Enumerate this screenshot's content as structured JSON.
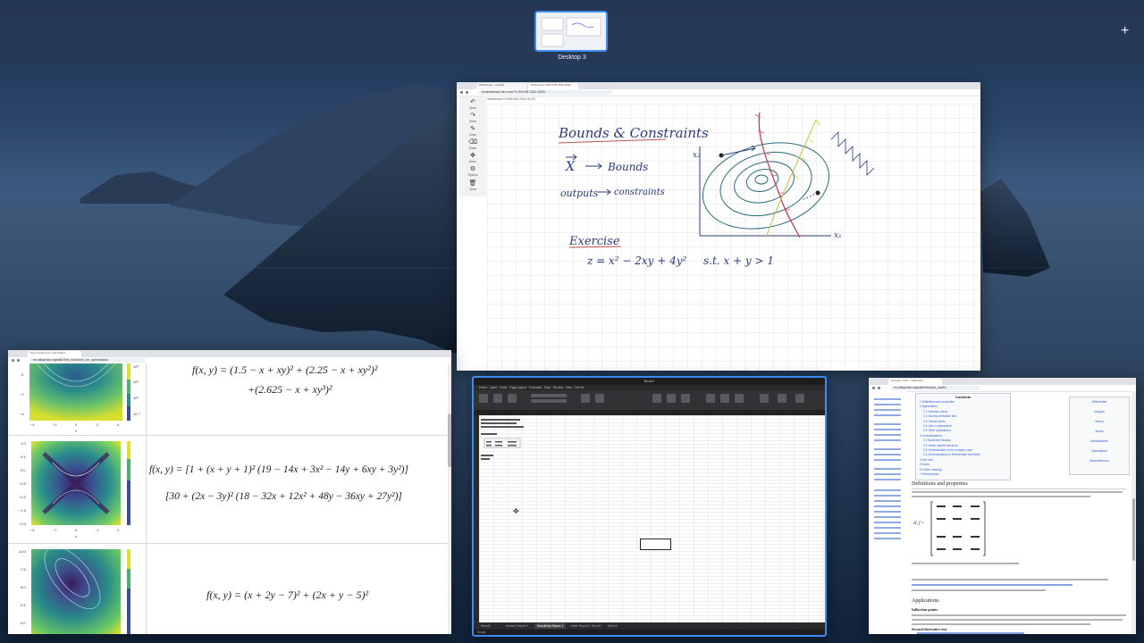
{
  "spaces": {
    "desktop_label": "Desktop 3",
    "add_symbol": "+"
  },
  "whiteboard": {
    "tabs": [
      "Whiteboard · Untitled",
      "Whiteboard 01BH13B-7842-9DZ0"
    ],
    "url": "ni.whiteboard-fire.com/?l=9H13B-7842-9DZ0",
    "board_name": "Whiteboard 01BH13B-7842-9DZ0",
    "tools": [
      {
        "icon": "undo-icon",
        "label": "Undo"
      },
      {
        "icon": "redo-icon",
        "label": "Redo"
      },
      {
        "icon": "pen-icon",
        "label": "Draw"
      },
      {
        "icon": "eraser-icon",
        "label": "Erase"
      },
      {
        "icon": "move-icon",
        "label": "Move"
      },
      {
        "icon": "gear-icon",
        "label": "Options"
      },
      {
        "icon": "trash-icon",
        "label": "Clear"
      }
    ],
    "handwriting": {
      "title": "Bounds & Constraints",
      "line1_left": "X",
      "line1_right": "Bounds",
      "line2_left": "outputs",
      "line2_right": "constraints",
      "exercise_title": "Exercise",
      "exercise_eq": "z = x² − 2xy + 4y²",
      "exercise_st": "s.t.  x + y > 1",
      "axis_y": "x₂",
      "axis_x": "x₁"
    }
  },
  "optimization": {
    "tab": "Test functions for optimization",
    "url": "en.wikipedia.org/wiki/Test_functions_for_optimization",
    "rows": [
      {
        "eq_line1": "f(x, y) = (1.5 − x + xy)² + (2.25 − x + xy²)²",
        "eq_line2": "+(2.625 − x + xy³)²",
        "ticks": [
          "−4",
          "−2",
          "0",
          "2",
          "4"
        ],
        "xlabel": "x"
      },
      {
        "eq_line1": "f(x, y) = [1 + (x + y + 1)² (19 − 14x + 3x² − 14y + 6xy + 3y²)]",
        "eq_line2": "[30 + (2x − 3y)² (18 − 32x + 12x² + 48y − 36xy + 27y²)]",
        "ticks": [
          "−2",
          "−1",
          "0",
          "1",
          "2"
        ],
        "xlabel": "x"
      },
      {
        "eq_line1": "f(x, y) = (x + 2y − 7)² + (2x + y − 5)²",
        "eq_line2": "",
        "ticks": [],
        "xlabel": ""
      }
    ],
    "yticks_row2": [
      "1.0",
      "0.5",
      "0.0",
      "−0.5",
      "−1.0",
      "−1.5",
      "−2.0"
    ],
    "yticks_row3": [
      "10.0",
      "7.5",
      "5.0",
      "2.5",
      "0.0"
    ],
    "yticks_row1": [
      "0",
      "−2",
      "−4"
    ],
    "colorbar_labels": [
      "10⁵",
      "10³",
      "10¹",
      "10⁻¹"
    ]
  },
  "excel": {
    "title": "Book1",
    "menu": [
      "Home",
      "Insert",
      "Draw",
      "Page Layout",
      "Formulas",
      "Data",
      "Review",
      "View",
      "Tell me"
    ],
    "sheets": [
      "Sheet1",
      "Answer Report 1",
      "Sensitivity Report 1",
      "Limits Report 1",
      "Sheet2",
      "Sheet3"
    ],
    "status": "Ready"
  },
  "hessian": {
    "tab": "Hessian matrix - Wikipedia",
    "url": "en.wikipedia.org/wiki/Hessian_matrix",
    "contents_title": "Contents",
    "contents": [
      "1 Definitions and properties",
      "2 Applications",
      "2.1 Inflection points",
      "2.2 Second-derivative test",
      "2.3 Critical points",
      "2.4 Use in optimization",
      "2.5 Other applications",
      "3 Generalizations",
      "3.1 Bordered Hessian",
      "3.2 Vector-valued functions",
      "3.3 Generalization to the complex case",
      "3.4 Generalizations to Riemannian manifolds",
      "4 See also",
      "5 Notes",
      "6 Further reading",
      "7 External links"
    ],
    "section1": "Definitions and properties",
    "section2": "Applications",
    "sub1": "Inflection points",
    "sub2": "Second-derivative test",
    "matrix_label": "H_f =",
    "infobox": [
      "Differential",
      "Integral",
      "Series",
      "Vector",
      "Multivariable",
      "Specialized",
      "Miscellaneous"
    ]
  }
}
